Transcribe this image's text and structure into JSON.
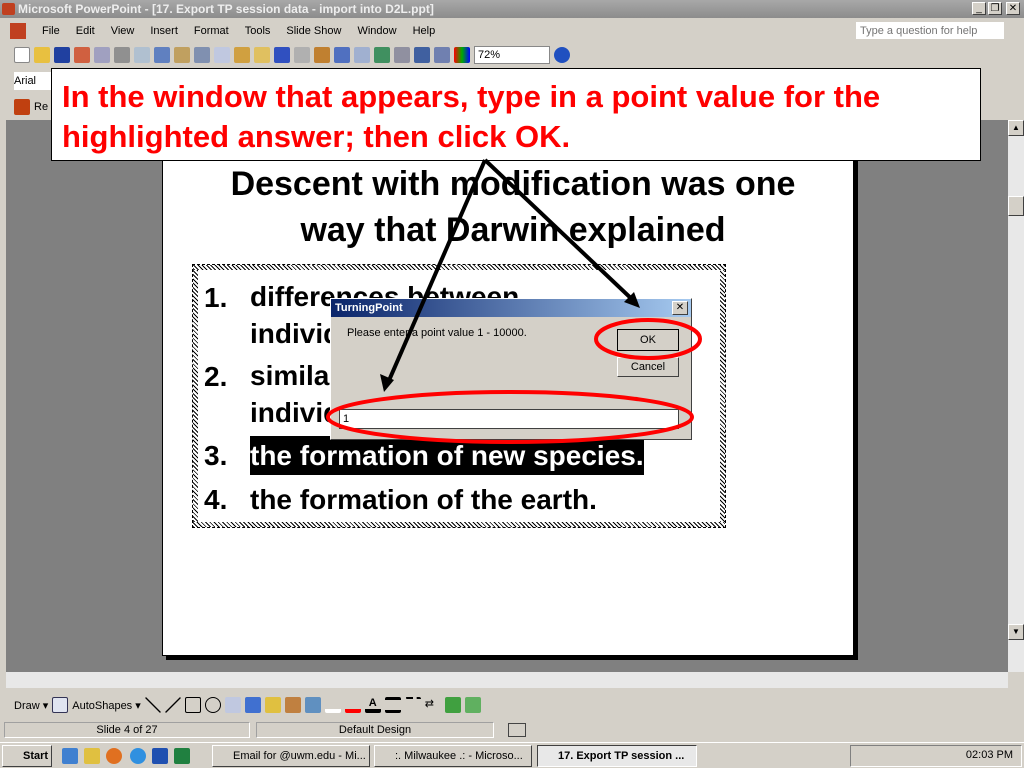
{
  "window": {
    "title": "Microsoft PowerPoint - [17. Export TP session data - import into D2L.ppt]",
    "help_placeholder": "Type a question for help"
  },
  "menu": [
    "File",
    "Edit",
    "View",
    "Insert",
    "Format",
    "Tools",
    "Slide Show",
    "Window",
    "Help"
  ],
  "toolbar": {
    "zoom": "72%",
    "font": "Arial",
    "third_label": "Re"
  },
  "callout": "In the window that appears, type in a point value for the highlighted answer; then click OK.",
  "slide": {
    "title": "Descent with modification was one way that Darwin explained",
    "items": [
      {
        "num": "1.",
        "text": "differences between individuals"
      },
      {
        "num": "2.",
        "text": "similarities between individuals"
      },
      {
        "num": "3.",
        "text": "the formation of new species."
      },
      {
        "num": "4.",
        "text": "the formation of the earth."
      }
    ]
  },
  "dialog": {
    "title": "TurningPoint",
    "prompt": "Please enter a point value 1 - 10000.",
    "ok": "OK",
    "cancel": "Cancel",
    "value": "1",
    "close": "✕"
  },
  "draw_toolbar": {
    "draw": "Draw ▾",
    "autoshapes": "AutoShapes ▾"
  },
  "status": {
    "slide": "Slide 4 of 27",
    "design": "Default Design"
  },
  "taskbar": {
    "start": "Start",
    "tasks": [
      "Email for @uwm.edu - Mi...",
      ":. Milwaukee .: - Microso...",
      "17. Export TP session ..."
    ],
    "clock": "02:03 PM"
  },
  "colors": {
    "accent_red": "#ff0000",
    "dialog_title": "#0a246a"
  }
}
